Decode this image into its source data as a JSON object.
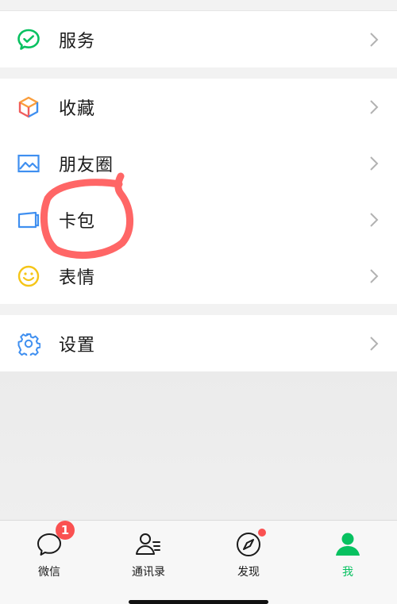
{
  "menu_groups": [
    {
      "items": [
        {
          "label": "服务",
          "icon": "wechat-pay-service-icon"
        }
      ]
    },
    {
      "items": [
        {
          "label": "收藏",
          "icon": "favorites-cube-icon"
        },
        {
          "label": "朋友圈",
          "icon": "moments-picture-icon"
        },
        {
          "label": "卡包",
          "icon": "card-wallet-icon"
        },
        {
          "label": "表情",
          "icon": "smiley-face-icon"
        }
      ]
    },
    {
      "items": [
        {
          "label": "设置",
          "icon": "gear-icon"
        }
      ]
    }
  ],
  "tabbar": {
    "tabs": [
      {
        "label": "微信",
        "icon": "chat-bubble-icon",
        "badge": "1"
      },
      {
        "label": "通讯录",
        "icon": "contacts-icon"
      },
      {
        "label": "发现",
        "icon": "compass-icon",
        "dot": true
      },
      {
        "label": "我",
        "icon": "person-icon",
        "active": true
      }
    ]
  },
  "colors": {
    "accent_green": "#07c160",
    "badge_red": "#fa5151",
    "annotation_red": "#ff3b3b"
  }
}
